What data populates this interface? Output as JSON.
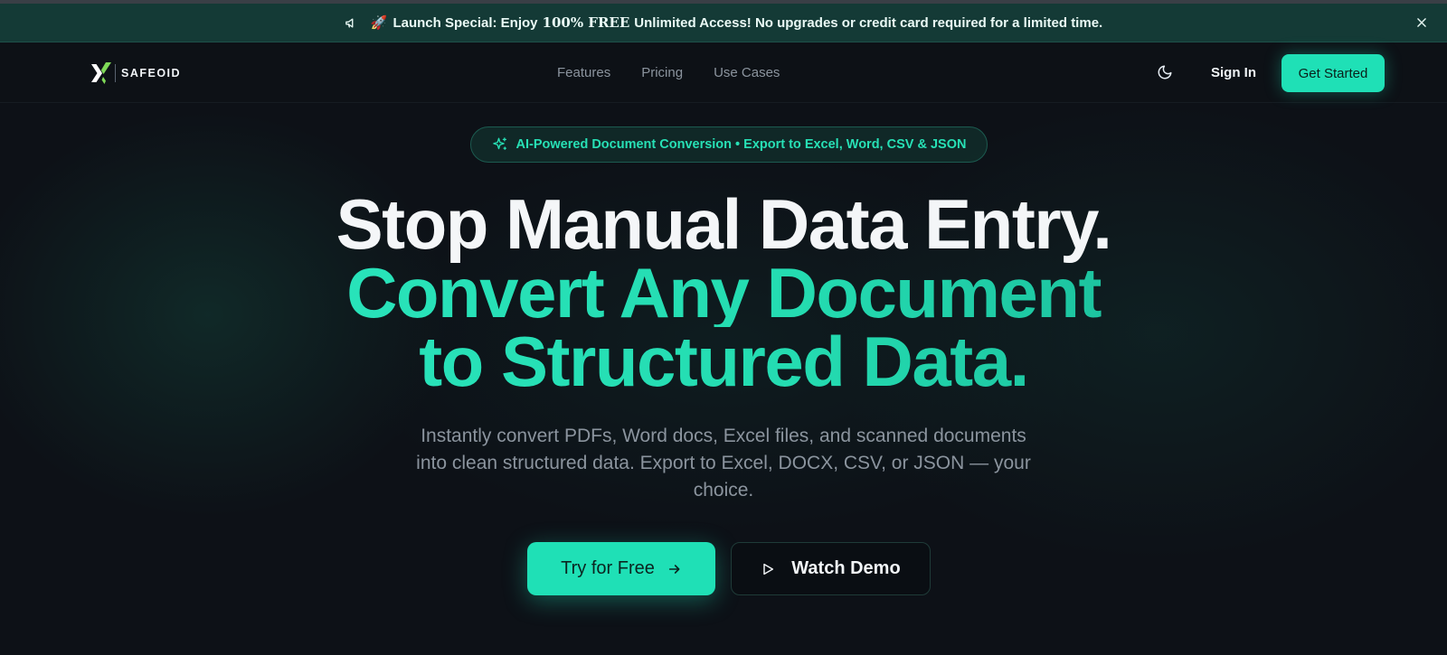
{
  "promo": {
    "emoji": "🚀",
    "text_before": "Launch Special: Enjoy",
    "highlight": "100% FREE",
    "text_after": "Unlimited Access! No upgrades or credit card required for a limited time."
  },
  "nav": {
    "logo_text": "SAFEOID",
    "links": [
      "Features",
      "Pricing",
      "Use Cases"
    ],
    "sign_in": "Sign In",
    "get_started": "Get Started"
  },
  "hero": {
    "badge": "AI-Powered Document Conversion • Export to Excel, Word, CSV & JSON",
    "title_line1": "Stop Manual Data Entry.",
    "title_line2": "Convert Any Document",
    "title_line3": "to Structured Data.",
    "subtitle": "Instantly convert PDFs, Word docs, Excel files, and scanned documents into clean structured data. Export to Excel, DOCX, CSV, or JSON — your choice.",
    "primary_cta": "Try for Free",
    "secondary_cta": "Watch Demo"
  },
  "colors": {
    "accent": "#1fe0b6",
    "background": "#0d1117",
    "promo_bg": "#143a36"
  },
  "icons": {
    "promo": "megaphone-icon",
    "close": "close-icon",
    "theme": "moon-icon",
    "badge": "sparkles-icon",
    "cta": "arrow-right-icon",
    "demo": "play-icon"
  }
}
